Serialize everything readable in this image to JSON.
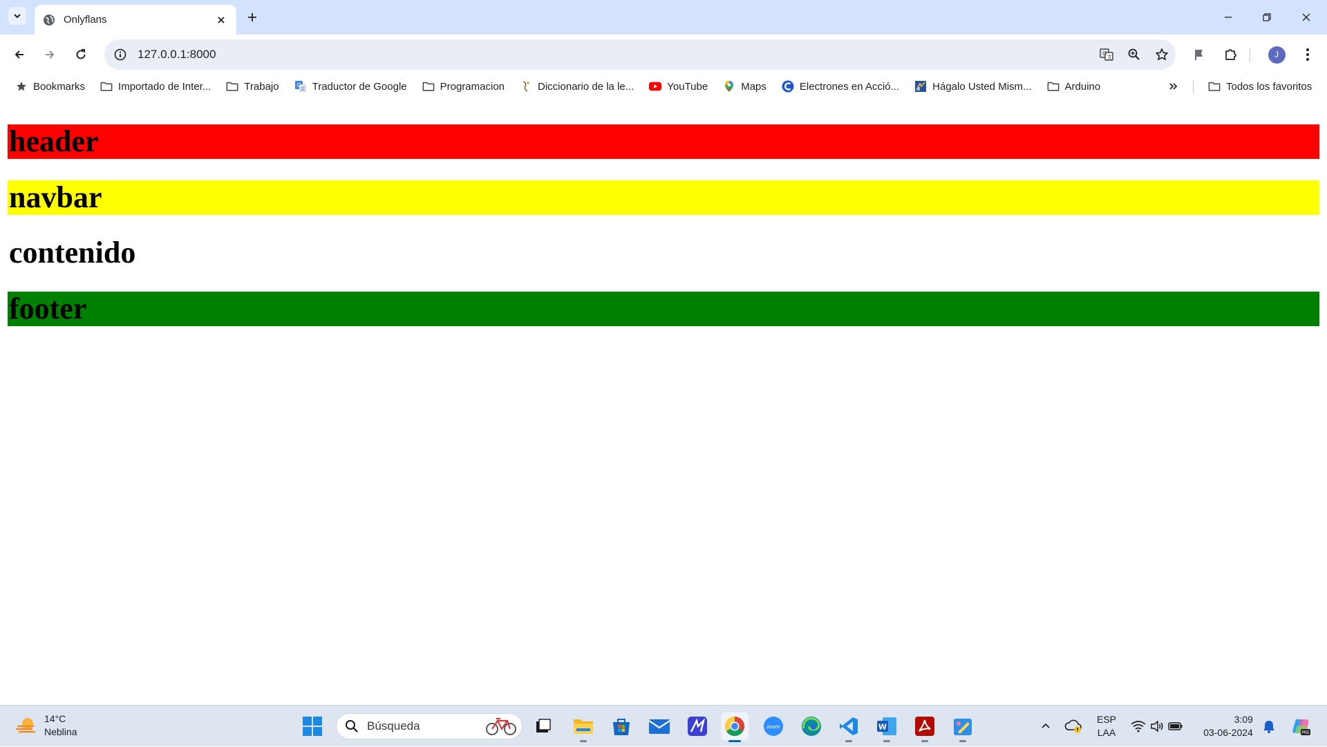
{
  "browser": {
    "tab": {
      "title": "Onlyflans"
    },
    "address": {
      "url": "127.0.0.1:8000"
    },
    "profile": {
      "initial": "J"
    },
    "bookmarks": [
      {
        "label": "Bookmarks",
        "icon": "star-icon"
      },
      {
        "label": "Importado de Inter...",
        "icon": "folder-icon"
      },
      {
        "label": "Trabajo",
        "icon": "folder-icon"
      },
      {
        "label": "Traductor de Google",
        "icon": "google-translate-icon"
      },
      {
        "label": "Programacion",
        "icon": "folder-icon"
      },
      {
        "label": "Diccionario de la le...",
        "icon": "rae-icon"
      },
      {
        "label": "YouTube",
        "icon": "youtube-icon"
      },
      {
        "label": "Maps",
        "icon": "maps-pin-icon"
      },
      {
        "label": "Electrones en Acció...",
        "icon": "electrones-icon"
      },
      {
        "label": "Hágalo Usted Mism...",
        "icon": "hagalo-icon"
      },
      {
        "label": "Arduino",
        "icon": "folder-icon"
      }
    ],
    "all_bookmarks": {
      "label": "Todos los favoritos"
    }
  },
  "page": {
    "header": {
      "text": "header",
      "color": "#ff0000"
    },
    "navbar": {
      "text": "navbar",
      "color": "#ffff00"
    },
    "content": {
      "text": "contenido"
    },
    "footer": {
      "text": "footer",
      "color": "#008000"
    }
  },
  "taskbar": {
    "weather": {
      "temp": "14°C",
      "condition": "Neblina"
    },
    "search": {
      "placeholder": "Búsqueda"
    },
    "apps": [
      "start",
      "task-view",
      "file-explorer",
      "microsoft-store",
      "mail",
      "affinity",
      "chrome",
      "zoom",
      "edge",
      "vscode",
      "word",
      "acrobat",
      "paint"
    ],
    "language": {
      "line1": "ESP",
      "line2": "LAA"
    },
    "clock": {
      "time": "3:09",
      "date": "03-06-2024"
    }
  }
}
